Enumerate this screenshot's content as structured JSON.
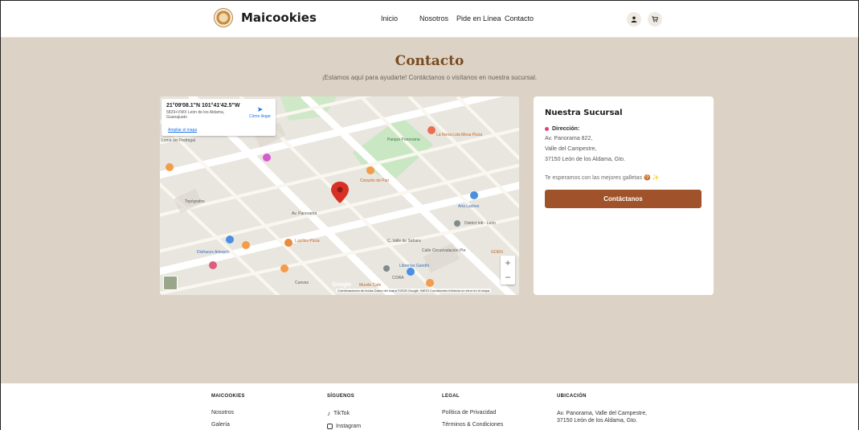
{
  "header": {
    "brand": "Maicookies",
    "nav": [
      "Inicio",
      "Nosotros",
      "Pide en Línea",
      "Contacto"
    ],
    "icons": [
      "user-icon",
      "cart-icon"
    ]
  },
  "page": {
    "title": "Contacto",
    "subtitle": "¡Estamos aquí para ayudarte! Contáctanos o visítanos en nuestra sucursal."
  },
  "map": {
    "coords": "21°09'08.1\"N 101°41'42.5\"W",
    "address": "5829+VWX León de los Aldama, Guanajuato",
    "enlarge": "Ampliar el mapa",
    "directions": "Cómo llegar",
    "google": "Google",
    "attribution": "Combinaciones de teclas   Datos del mapa ©2025 Google, INEGI   Condiciones   Informar un error en el mapa",
    "labels": {
      "a": "Loma del Pedregal",
      "b": "Parque Panorama",
      "c": "La Nona Lola Mesa Pizza",
      "d": "Corazón de Pan",
      "e": "Lupillos Pizza",
      "f": "District Ink - León",
      "g": "Aria Lashes",
      "h": "Disfraces Arlequín",
      "i": "Librerías Gandhi",
      "j": "Mundo Cafe",
      "k": "Av. Panorama",
      "l": "C. Valle de Sahara",
      "m": "Calle Circunvalación Pte",
      "n": "Topógrafos",
      "o": "Cuevas",
      "p": "CORA",
      "q": "GOEN"
    }
  },
  "branch": {
    "title": "Nuestra Sucursal",
    "dir_label": "Dirección:",
    "address_lines": [
      "Av. Panorama 822,",
      "Valle del Campestre,",
      "37150 León de los Aldama, Gto."
    ],
    "wait": "Te esperamos con las mejores galletas 🍪 ✨",
    "cta": "Contáctanos"
  },
  "footer": {
    "col1": {
      "heading": "MAICOOKIES",
      "items": [
        "Nosotros",
        "Galería"
      ]
    },
    "col2": {
      "heading": "SÍGUENOS",
      "items": [
        "TikTok",
        "Instagram"
      ]
    },
    "col3": {
      "heading": "LEGAL",
      "items": [
        "Política de Privacidad",
        "Términos & Condiciones"
      ]
    },
    "col4": {
      "heading": "UBICACIÓN",
      "lines": [
        "Av. Panorama, Valle del Campestre,",
        "37150 León de los Aldama, Gto."
      ]
    }
  },
  "colors": {
    "background": "#dcd3c6",
    "brand_brown": "#7a4a1f",
    "button": "#a0532a",
    "map_pin": "#d93025"
  }
}
